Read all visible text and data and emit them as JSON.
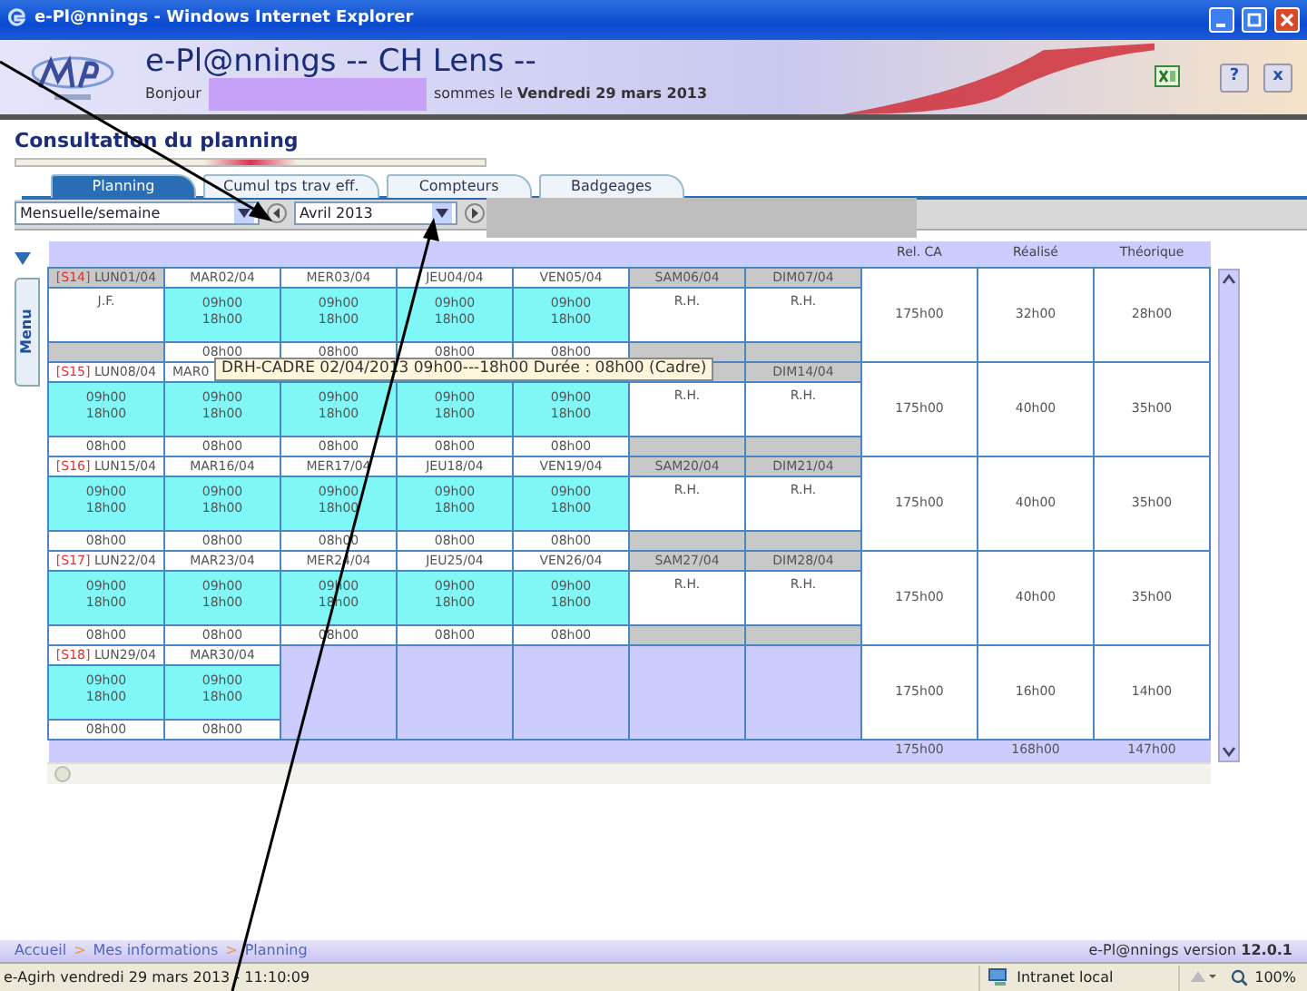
{
  "window": {
    "title": "e-Pl@nnings - Windows Internet Explorer"
  },
  "header": {
    "app_title": "e-Pl@nnings -- CH Lens --",
    "greeting_start": "Bonjour",
    "greeting_end": "sommes le **Vendredi 29 mars 2013**",
    "buttons": [
      "?",
      "x"
    ]
  },
  "page_title": "Consultation du planning",
  "tabs": [
    {
      "label": "Planning",
      "selected": true
    },
    {
      "label": "Cumul tps trav eff.",
      "selected": false
    },
    {
      "label": "Compteurs",
      "selected": false
    },
    {
      "label": "Badgeages",
      "selected": false
    }
  ],
  "filters": {
    "view": "Mensuelle/semaine",
    "month": "Avril 2013"
  },
  "menu_tab": "Menu",
  "planning": {
    "columns": [
      "Rel. CA",
      "Réalisé",
      "Théorique"
    ],
    "weeks": [
      {
        "week": "[S14]",
        "summary": [
          "175h00",
          "32h00",
          "28h00"
        ],
        "days": [
          {
            "kind": "holiday",
            "header": "LUN01/04",
            "label": "J.F."
          },
          {
            "kind": "work",
            "header": "MAR02/04",
            "start": "09h00",
            "end": "18h00",
            "duration": "08h00"
          },
          {
            "kind": "work",
            "header": "MER03/04",
            "start": "09h00",
            "end": "18h00",
            "duration": "08h00"
          },
          {
            "kind": "work",
            "header": "JEU04/04",
            "start": "09h00",
            "end": "18h00",
            "duration": "08h00"
          },
          {
            "kind": "work",
            "header": "VEN05/04",
            "start": "09h00",
            "end": "18h00",
            "duration": "08h00"
          },
          {
            "kind": "rest",
            "header": "SAM06/04",
            "label": "R.H."
          },
          {
            "kind": "rest",
            "header": "DIM07/04",
            "label": "R.H."
          }
        ]
      },
      {
        "week": "[S15]",
        "summary": [
          "175h00",
          "40h00",
          "35h00"
        ],
        "days": [
          {
            "kind": "work",
            "header": "LUN08/04",
            "start": "09h00",
            "end": "18h00",
            "duration": "08h00"
          },
          {
            "kind": "work",
            "header": "MAR0",
            "tooltip": "DRH-CADRE 02/04/2013 09h00---18h00 Durée : 08h00 (Cadre)",
            "start": "09h00",
            "end": "18h00",
            "duration": "08h00"
          },
          {
            "kind": "work",
            "start": "09h00",
            "end": "18h00",
            "duration": "08h00"
          },
          {
            "kind": "work",
            "start": "09h00",
            "end": "18h00",
            "duration": "08h00"
          },
          {
            "kind": "work",
            "start": "09h00",
            "end": "18h00",
            "duration": "08h00"
          },
          {
            "kind": "rest",
            "label": "R.H."
          },
          {
            "kind": "rest",
            "header": "DIM14/04",
            "label": "R.H."
          }
        ]
      },
      {
        "week": "[S16]",
        "summary": [
          "175h00",
          "40h00",
          "35h00"
        ],
        "days": [
          {
            "kind": "work",
            "header": "LUN15/04",
            "start": "09h00",
            "end": "18h00",
            "duration": "08h00"
          },
          {
            "kind": "work",
            "header": "MAR16/04",
            "start": "09h00",
            "end": "18h00",
            "duration": "08h00"
          },
          {
            "kind": "work",
            "header": "MER17/04",
            "start": "09h00",
            "end": "18h00",
            "duration": "08h00"
          },
          {
            "kind": "work",
            "header": "JEU18/04",
            "start": "09h00",
            "end": "18h00",
            "duration": "08h00"
          },
          {
            "kind": "work",
            "header": "VEN19/04",
            "start": "09h00",
            "end": "18h00",
            "duration": "08h00"
          },
          {
            "kind": "rest",
            "header": "SAM20/04",
            "label": "R.H."
          },
          {
            "kind": "rest",
            "header": "DIM21/04",
            "label": "R.H."
          }
        ]
      },
      {
        "week": "[S17]",
        "summary": [
          "175h00",
          "40h00",
          "35h00"
        ],
        "days": [
          {
            "kind": "work",
            "header": "LUN22/04",
            "start": "09h00",
            "end": "18h00",
            "duration": "08h00"
          },
          {
            "kind": "work",
            "header": "MAR23/04",
            "start": "09h00",
            "end": "18h00",
            "duration": "08h00"
          },
          {
            "kind": "work",
            "header": "MER24/04",
            "start": "09h00",
            "end": "18h00",
            "duration": "08h00"
          },
          {
            "kind": "work",
            "header": "JEU25/04",
            "start": "09h00",
            "end": "18h00",
            "duration": "08h00"
          },
          {
            "kind": "work",
            "header": "VEN26/04",
            "start": "09h00",
            "end": "18h00",
            "duration": "08h00"
          },
          {
            "kind": "rest",
            "header": "SAM27/04",
            "label": "R.H."
          },
          {
            "kind": "rest",
            "header": "DIM28/04",
            "label": "R.H."
          }
        ]
      },
      {
        "week": "[S18]",
        "summary": [
          "175h00",
          "16h00",
          "14h00"
        ],
        "days": [
          {
            "kind": "work",
            "header": "LUN29/04",
            "start": "09h00",
            "end": "18h00",
            "duration": "08h00"
          },
          {
            "kind": "work",
            "header": "MAR30/04",
            "start": "09h00",
            "end": "18h00",
            "duration": "08h00"
          }
        ]
      }
    ],
    "totals": [
      "175h00",
      "168h00",
      "147h00"
    ]
  },
  "footer": {
    "breadcrumb": [
      {
        "kind": "link",
        "text": "Accueil"
      },
      {
        "kind": "sep",
        "text": ">"
      },
      {
        "kind": "link",
        "text": "Mes informations"
      },
      {
        "kind": "sep",
        "text": ">"
      },
      {
        "kind": "link",
        "text": "Planning"
      }
    ],
    "version": "e-Pl@nnings version **12.0.1**"
  },
  "status_bar": {
    "text": "e-Agirh vendredi 29 mars 2013 - 11:10:09",
    "zone": "Intranet local",
    "zoom": "100%"
  }
}
